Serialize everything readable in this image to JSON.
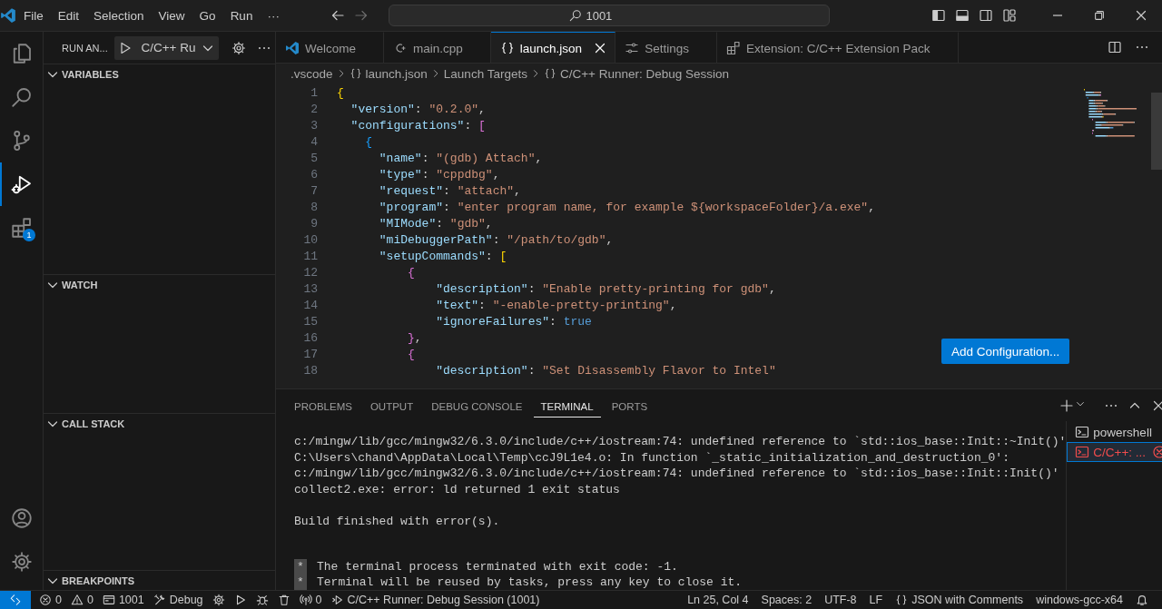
{
  "title_bar": {
    "menu": [
      "File",
      "Edit",
      "Selection",
      "View",
      "Go",
      "Run",
      "···"
    ],
    "search": "1001"
  },
  "activity_bar": {
    "items": [
      {
        "kind": "files",
        "selected": false
      },
      {
        "kind": "search",
        "selected": false
      },
      {
        "kind": "scm",
        "selected": false
      },
      {
        "kind": "debug",
        "selected": true
      },
      {
        "kind": "extensions",
        "selected": false,
        "badge": "1"
      }
    ],
    "bottom": [
      {
        "kind": "account"
      },
      {
        "kind": "manage"
      }
    ]
  },
  "sidebar": {
    "title": "RUN AN...",
    "config": "C/C++ Ru",
    "sections": [
      {
        "label": "VARIABLES",
        "expanded": true
      },
      {
        "label": "WATCH",
        "expanded": true
      },
      {
        "label": "CALL STACK",
        "expanded": true
      },
      {
        "label": "BREAKPOINTS",
        "expanded": true
      }
    ]
  },
  "tabs": [
    {
      "label": "Welcome",
      "kind": "vscode",
      "selected": false
    },
    {
      "label": "main.cpp",
      "kind": "cpp",
      "selected": false
    },
    {
      "label": "launch.json",
      "kind": "json",
      "selected": true
    },
    {
      "label": "Settings",
      "kind": "settings",
      "selected": false
    },
    {
      "label": "Extension: C/C++ Extension Pack",
      "kind": "extension",
      "selected": false
    }
  ],
  "breadcrumb": [
    {
      "kind": "folder",
      "text": ".vscode"
    },
    {
      "kind": "json",
      "text": "launch.json"
    },
    {
      "kind": "plain",
      "text": "Launch Targets"
    },
    {
      "kind": "object",
      "text": "C/C++ Runner: Debug Session"
    }
  ],
  "editor": {
    "lines": [
      {
        "number": "1",
        "tokens": [
          {
            "kind": "b1",
            "text": "{"
          }
        ]
      },
      {
        "number": "2",
        "tokens": [
          {
            "kind": "key",
            "text": "  \"version\""
          },
          {
            "kind": "p",
            "text": ": "
          },
          {
            "kind": "str",
            "text": "\"0.2.0\""
          },
          {
            "kind": "p",
            "text": ","
          }
        ]
      },
      {
        "number": "3",
        "tokens": [
          {
            "kind": "key",
            "text": "  \"configurations\""
          },
          {
            "kind": "p",
            "text": ": "
          },
          {
            "kind": "b2",
            "text": "["
          }
        ]
      },
      {
        "number": "4",
        "tokens": [
          {
            "kind": "b3",
            "text": "    {"
          }
        ]
      },
      {
        "number": "5",
        "tokens": [
          {
            "kind": "key",
            "text": "      \"name\""
          },
          {
            "kind": "p",
            "text": ": "
          },
          {
            "kind": "str",
            "text": "\"(gdb) Attach\""
          },
          {
            "kind": "p",
            "text": ","
          }
        ]
      },
      {
        "number": "6",
        "tokens": [
          {
            "kind": "key",
            "text": "      \"type\""
          },
          {
            "kind": "p",
            "text": ": "
          },
          {
            "kind": "str",
            "text": "\"cppdbg\""
          },
          {
            "kind": "p",
            "text": ","
          }
        ]
      },
      {
        "number": "7",
        "tokens": [
          {
            "kind": "key",
            "text": "      \"request\""
          },
          {
            "kind": "p",
            "text": ": "
          },
          {
            "kind": "str",
            "text": "\"attach\""
          },
          {
            "kind": "p",
            "text": ","
          }
        ]
      },
      {
        "number": "8",
        "tokens": [
          {
            "kind": "key",
            "text": "      \"program\""
          },
          {
            "kind": "p",
            "text": ": "
          },
          {
            "kind": "str",
            "text": "\"enter program name, for example ${workspaceFolder}/a.exe\""
          },
          {
            "kind": "p",
            "text": ","
          }
        ]
      },
      {
        "number": "9",
        "tokens": [
          {
            "kind": "key",
            "text": "      \"MIMode\""
          },
          {
            "kind": "p",
            "text": ": "
          },
          {
            "kind": "str",
            "text": "\"gdb\""
          },
          {
            "kind": "p",
            "text": ","
          }
        ]
      },
      {
        "number": "10",
        "tokens": [
          {
            "kind": "key",
            "text": "      \"miDebuggerPath\""
          },
          {
            "kind": "p",
            "text": ": "
          },
          {
            "kind": "str",
            "text": "\"/path/to/gdb\""
          },
          {
            "kind": "p",
            "text": ","
          }
        ]
      },
      {
        "number": "11",
        "tokens": [
          {
            "kind": "key",
            "text": "      \"setupCommands\""
          },
          {
            "kind": "p",
            "text": ": "
          },
          {
            "kind": "b1",
            "text": "["
          }
        ]
      },
      {
        "number": "12",
        "tokens": [
          {
            "kind": "b2",
            "text": "          {"
          }
        ]
      },
      {
        "number": "13",
        "tokens": [
          {
            "kind": "key",
            "text": "              \"description\""
          },
          {
            "kind": "p",
            "text": ": "
          },
          {
            "kind": "str",
            "text": "\"Enable pretty-printing for gdb\""
          },
          {
            "kind": "p",
            "text": ","
          }
        ]
      },
      {
        "number": "14",
        "tokens": [
          {
            "kind": "key",
            "text": "              \"text\""
          },
          {
            "kind": "p",
            "text": ": "
          },
          {
            "kind": "str",
            "text": "\"-enable-pretty-printing\""
          },
          {
            "kind": "p",
            "text": ","
          }
        ]
      },
      {
        "number": "15",
        "tokens": [
          {
            "kind": "key",
            "text": "              \"ignoreFailures\""
          },
          {
            "kind": "p",
            "text": ": "
          },
          {
            "kind": "bool",
            "text": "true"
          }
        ]
      },
      {
        "number": "16",
        "tokens": [
          {
            "kind": "b2",
            "text": "          }"
          },
          {
            "kind": "p",
            "text": ","
          }
        ]
      },
      {
        "number": "17",
        "tokens": [
          {
            "kind": "b2",
            "text": "          {"
          }
        ]
      },
      {
        "number": "18",
        "tokens": [
          {
            "kind": "key",
            "text": "              \"description\""
          },
          {
            "kind": "p",
            "text": ": "
          },
          {
            "kind": "str",
            "text": "\"Set Disassembly Flavor to Intel\""
          }
        ]
      }
    ],
    "button": "Add Configuration..."
  },
  "panel": {
    "tabs": [
      {
        "label": "PROBLEMS",
        "selected": false
      },
      {
        "label": "OUTPUT",
        "selected": false
      },
      {
        "label": "DEBUG CONSOLE",
        "selected": false
      },
      {
        "label": "TERMINAL",
        "selected": true
      },
      {
        "label": "PORTS",
        "selected": false
      }
    ],
    "output_blocks": [
      [
        "c:/mingw/lib/gcc/mingw32/6.3.0/include/c++/iostream:74: undefined reference to `std::ios_base::Init::~Init()'",
        "C:\\Users\\chand\\AppData\\Local\\Temp\\ccJ9L1e4.o: In function `_static_initialization_and_destruction_0':",
        "c:/mingw/lib/gcc/mingw32/6.3.0/include/c++/iostream:74: undefined reference to `std::ios_base::Init::Init()'",
        "collect2.exe: error: ld returned 1 exit status"
      ],
      [
        "Build finished with error(s)."
      ]
    ],
    "notices": [
      {
        "marker": "*",
        "text": "The terminal process terminated with exit code: -1."
      },
      {
        "marker": "*",
        "text": "Terminal will be reused by tasks, press any key to close it."
      }
    ],
    "terminals": [
      {
        "label": "powershell",
        "selected": false,
        "error": false
      },
      {
        "label": "C/C++: ...",
        "selected": true,
        "error": true
      }
    ]
  },
  "status_bar": {
    "left": [
      {
        "kind": "remote"
      },
      {
        "kind": "errors",
        "text": "0"
      },
      {
        "kind": "warnings",
        "text": "0"
      },
      {
        "kind": "ports",
        "text": "1001"
      },
      {
        "kind": "tools",
        "text": "Debug"
      },
      {
        "kind": "gear"
      },
      {
        "kind": "play"
      },
      {
        "kind": "bug"
      },
      {
        "kind": "trash"
      },
      {
        "kind": "antenna",
        "text": "0"
      },
      {
        "kind": "launch",
        "text": "C/C++ Runner: Debug Session (1001)"
      }
    ],
    "right": [
      {
        "kind": "plain",
        "text": "Ln 25, Col 4"
      },
      {
        "kind": "plain",
        "text": "Spaces: 2"
      },
      {
        "kind": "plain",
        "text": "UTF-8"
      },
      {
        "kind": "plain",
        "text": "LF"
      },
      {
        "kind": "braces",
        "text": "JSON with Comments"
      },
      {
        "kind": "plain",
        "text": "windows-gcc-x64"
      },
      {
        "kind": "bell"
      }
    ]
  }
}
